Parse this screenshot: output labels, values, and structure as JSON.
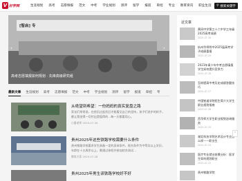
{
  "header": {
    "logo_text": "好学网",
    "nav": [
      "生涯规划",
      "高考",
      "志愿填报",
      "范文",
      "中考",
      "学业规划",
      "测评",
      "留学",
      "报道",
      "单招",
      "专业",
      "教育资讯",
      "职业生涯"
    ],
    "search_label": "搜索关键字"
  },
  "hero": {
    "banner_text": "[智启] 专",
    "caption": "高考志愿填报如何规划 · 先锋高级研究组"
  },
  "tabs": [
    "最新文章",
    "生涯规划",
    "高考",
    "志愿填报",
    "范文",
    "中考",
    "学业规划",
    "测评",
    "留学",
    "报道",
    "单招",
    "专"
  ],
  "articles": [
    {
      "title": "从绝望到希望：一份妈妈的真实复盘之路",
      "desc": "家长们常常说，在经历过起伏后才能看见自己的坚持，孩子们进步的样子，都让我觉得一切付出是值得的...每一天都要用心。",
      "meta": "小唐老师    2025-07-30"
    },
    {
      "title": "贵州2025年这些铁路学校需要什么条件",
      "desc": "贵州铁路学校要求学生具备一定的身体条件，报名条件为中等及以上学历，年龄在十五周岁以上，需通过体检并参加综合测试...",
      "meta": "教育大家    2025-07-28"
    },
    {
      "title": "贵州2025年男生读铁路学校好不好"
    }
  ],
  "sidebar": {
    "title": "近文章",
    "items": [
      {
        "text": "黄冈中学第三十六中学三年级2025高考成绩",
        "date": "2025-07-30"
      },
      {
        "text": "杭州华师附中2025届高考学子成绩喜报",
        "date": "2025-07-29"
      },
      {
        "text": "2023年青少年中考志愿填报学生如何提升竞争力",
        "date": "2025-07-28"
      },
      {
        "text": "怎样提高中考历史成绩答题技巧",
        "date": "2025-07-27"
      },
      {
        "text": "中国铁道学院招生简介大学生职业规划指南",
        "date": "2025-07-26"
      },
      {
        "text": "西华师大学生职业规划咨询服务",
        "date": "2025-07-25"
      },
      {
        "text": "湖北科技学院艺术设计专业怎么样——职业生",
        "date": "2025-07-24"
      },
      {
        "text": "医疗专业就业前景分析：医学生如何规划职业",
        "date": "2025-07-23"
      },
      {
        "text": "贵州铁路学院",
        "date": ""
      }
    ]
  },
  "colors": {
    "brand": "#c8102e",
    "search_bg": "#1a1a1a"
  }
}
